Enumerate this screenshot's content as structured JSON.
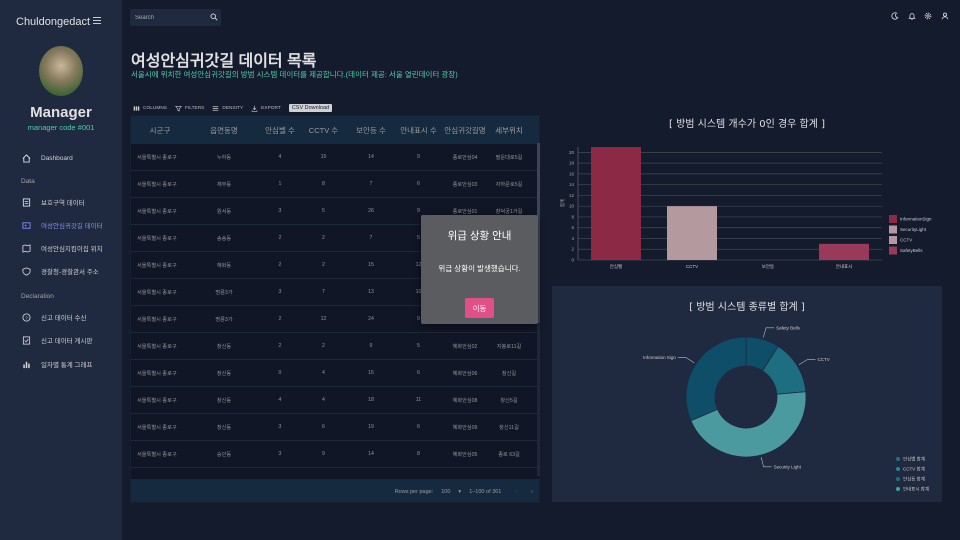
{
  "app": {
    "brand": "Chuldongedact"
  },
  "user": {
    "name": "Manager",
    "code": "manager code #001"
  },
  "nav": {
    "dashboard": "Dashboard",
    "section_data": "Data",
    "section_declaration": "Declaration",
    "items": [
      {
        "label": "보호구역 데이터",
        "icon": "people-icon"
      },
      {
        "label": "여성안심귀갓길 데이터",
        "icon": "contacts-icon"
      },
      {
        "label": "여성안심지킴이집 위치",
        "icon": "map-icon"
      },
      {
        "label": "경찰청-경찰관서 주소",
        "icon": "shield-icon"
      }
    ],
    "declaration_items": [
      {
        "label": "신고 데이터 수신",
        "icon": "help-icon"
      },
      {
        "label": "신고 데이터 게시판",
        "icon": "checklist-icon"
      },
      {
        "label": "일자별 통계 그래프",
        "icon": "bar-chart-icon"
      }
    ]
  },
  "search": {
    "placeholder": "Search"
  },
  "page": {
    "title": "여성안심귀갓길 데이터 목록",
    "subtitle": "서울시에 위치한 여성안심귀갓길의 방범 시스템 데이터를 제공합니다.(데이터 제공: 서울 열린데이터 광장)"
  },
  "toolbar": {
    "columns": "COLUMNS",
    "filters": "FILTERS",
    "density": "DENSITY",
    "export": "EXPORT",
    "csv": "CSV Download"
  },
  "table": {
    "columns": [
      "시군구",
      "읍면동명",
      "안심벨 수",
      "CCTV 수",
      "보안등 수",
      "안내표시 수",
      "안심귀갓길명",
      "세부위치"
    ],
    "rows": [
      [
        "서울특별시 종로구",
        "누하동",
        "4",
        "15",
        "14",
        "9",
        "종로안심04",
        "필운대로5길"
      ],
      [
        "서울특별시 종로구",
        "체부동",
        "1",
        "8",
        "7",
        "6",
        "종로안심03",
        "자하문로5길"
      ],
      [
        "서울특별시 종로구",
        "원서동",
        "3",
        "5",
        "26",
        "9",
        "종로안심01",
        "창덕궁1가길"
      ],
      [
        "서울특별시 종로구",
        "송송동",
        "2",
        "2",
        "7",
        "5",
        "",
        ""
      ],
      [
        "서울특별시 종로구",
        "혜화동",
        "2",
        "2",
        "15",
        "12",
        "",
        ""
      ],
      [
        "서울특별시 종로구",
        "명륜3가",
        "3",
        "7",
        "13",
        "10",
        "",
        ""
      ],
      [
        "서울특별시 종로구",
        "명륜3가",
        "2",
        "12",
        "24",
        "9",
        "",
        ""
      ],
      [
        "서울특별시 종로구",
        "창신동",
        "2",
        "2",
        "9",
        "5",
        "혜화안심02",
        "지봉로11길"
      ],
      [
        "서울특별시 종로구",
        "창신동",
        "0",
        "4",
        "15",
        "6",
        "혜화안심06",
        "창신길"
      ],
      [
        "서울특별시 종로구",
        "창신동",
        "4",
        "4",
        "18",
        "11",
        "혜화안심08",
        "창신5길"
      ],
      [
        "서울특별시 종로구",
        "창신동",
        "3",
        "6",
        "19",
        "6",
        "혜화안심09",
        "창신11길"
      ],
      [
        "서울특별시 종로구",
        "숭인동",
        "3",
        "9",
        "14",
        "8",
        "혜화안심05",
        "종로 63길"
      ]
    ],
    "footer": {
      "rows_per_page_label": "Rows per page:",
      "rows_per_page": "100",
      "range": "1–100 of 361"
    }
  },
  "modal": {
    "title": "위급 상황 안내",
    "message": "위급 상황이 발생했습니다.",
    "button": "이동"
  },
  "colors": {
    "accent_green": "#4cceac",
    "modal_button": "#e04f86",
    "bar1": "#8c2a45",
    "bar2": "#b49a9e",
    "bar3": "#9a3a58",
    "donut_dark": "#0e4e68",
    "donut_mid": "#1d6e80",
    "donut_light": "#4a9aa0"
  },
  "chart_data": [
    {
      "type": "bar",
      "title": "[ 방범 시스템 개수가 0인 경우 합계 ]",
      "ylabel": "합계",
      "categories": [
        "안심벨",
        "CCTV",
        "보안등",
        "안내표시"
      ],
      "values": [
        21,
        10,
        0,
        3
      ],
      "ylim": [
        0,
        21
      ],
      "yticks": [
        "0",
        "2",
        "4",
        "6",
        "8",
        "10",
        "12",
        "14",
        "16",
        "18",
        "20"
      ],
      "legend": [
        "InformationSign",
        "SecurityLight",
        "CCTV",
        "SafetyBells"
      ],
      "legend_placement": "right"
    },
    {
      "type": "pie",
      "title": "[ 방범 시스템 종류별 합계 ]",
      "labels": [
        "Safety Bells",
        "CCTV",
        "Security Light",
        "Information Sign"
      ],
      "values": [
        8,
        13,
        40,
        28
      ],
      "legend": [
        "안심벨 합계",
        "CCTV 합계",
        "안심등 합계",
        "안내표시 합계"
      ],
      "legend_placement": "bottom-right"
    }
  ]
}
